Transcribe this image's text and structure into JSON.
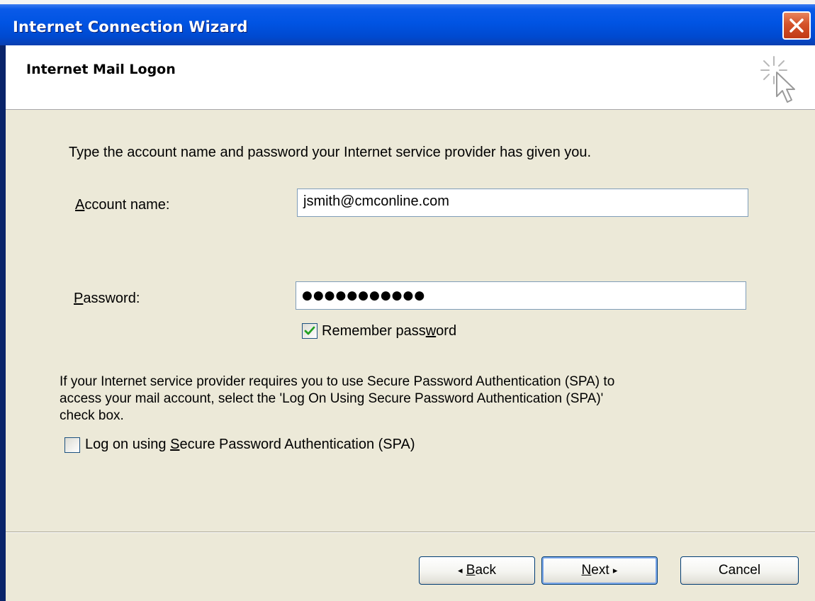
{
  "window": {
    "title": "Internet Connection Wizard"
  },
  "header": {
    "title": "Internet Mail Logon"
  },
  "form": {
    "intro": "Type the account name and password your Internet service provider has given you.",
    "account_label_key": "A",
    "account_label_rest": "ccount name:",
    "account_value": "jsmith@cmconline.com",
    "password_label_key": "P",
    "password_label_rest": "assword:",
    "password_mask": "●●●●●●●●●●●",
    "remember_label_a": "Remember pass",
    "remember_label_key": "w",
    "remember_label_b": "ord",
    "remember_checked": true,
    "spa_text_1": "If your Internet service provider requires you to use Secure Password Authentication (SPA) to",
    "spa_text_2": "access your mail account, select the 'Log On Using Secure Password Authentication (SPA)'",
    "spa_text_3": "check box.",
    "spa_label_a": "Log on using ",
    "spa_label_key": "S",
    "spa_label_b": "ecure Password Authentication (SPA)",
    "spa_checked": false
  },
  "buttons": {
    "back_key": "B",
    "back_rest": "ack",
    "next_key": "N",
    "next_rest": "ext",
    "cancel": "Cancel"
  },
  "colors": {
    "titlebar": "#0054e3",
    "dialog_bg": "#ece9d8",
    "close_button": "#d4532a",
    "check_mark": "#21a121"
  }
}
